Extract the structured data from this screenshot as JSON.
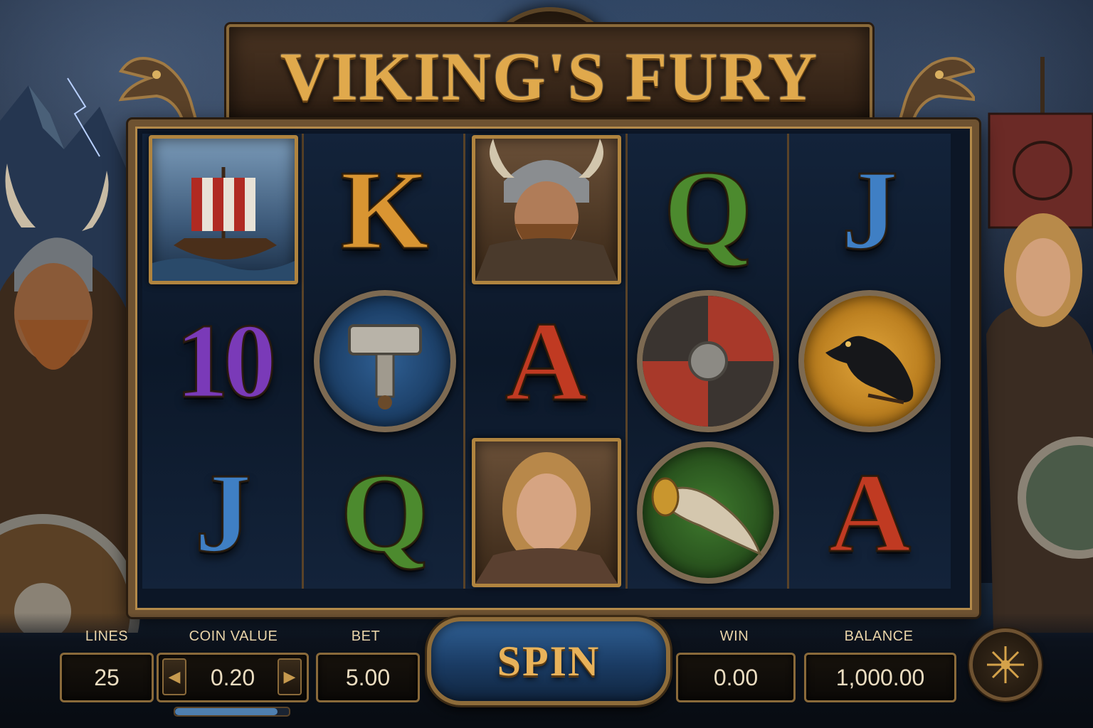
{
  "game": {
    "title": "VIKING'S FURY"
  },
  "reels": [
    [
      {
        "symbol": "longship",
        "kind": "card"
      },
      {
        "symbol": "10",
        "kind": "letter",
        "color": "#7a3ab8"
      },
      {
        "symbol": "J",
        "kind": "letter",
        "color": "#3f7fc4"
      }
    ],
    [
      {
        "symbol": "K",
        "kind": "letter",
        "color": "#d99532"
      },
      {
        "symbol": "hammer",
        "kind": "coin"
      },
      {
        "symbol": "Q",
        "kind": "letter",
        "color": "#4c8a2e"
      }
    ],
    [
      {
        "symbol": "viking-warrior",
        "kind": "card"
      },
      {
        "symbol": "A",
        "kind": "letter",
        "color": "#c03a22"
      },
      {
        "symbol": "shieldmaiden",
        "kind": "card"
      }
    ],
    [
      {
        "symbol": "Q",
        "kind": "letter",
        "color": "#4c8a2e"
      },
      {
        "symbol": "shield",
        "kind": "coin"
      },
      {
        "symbol": "drinking-horn",
        "kind": "coin"
      }
    ],
    [
      {
        "symbol": "J",
        "kind": "letter",
        "color": "#3f7fc4"
      },
      {
        "symbol": "raven",
        "kind": "coin"
      },
      {
        "symbol": "A",
        "kind": "letter",
        "color": "#c03a22"
      }
    ]
  ],
  "controls": {
    "lines_label": "LINES",
    "lines_value": "25",
    "coin_label": "COIN VALUE",
    "coin_value": "0.20",
    "coin_decrease": "◀",
    "coin_increase": "▶",
    "bet_label": "BET",
    "bet_value": "5.00",
    "spin_label": "SPIN",
    "win_label": "WIN",
    "win_value": "0.00",
    "balance_label": "BALANCE",
    "balance_value": "1,000.00"
  },
  "icons": {
    "menu": "rune-compass-icon"
  },
  "colors": {
    "gold": "#e0a94c",
    "frame": "#6e5231",
    "spin_blue": "#2f5f93"
  }
}
